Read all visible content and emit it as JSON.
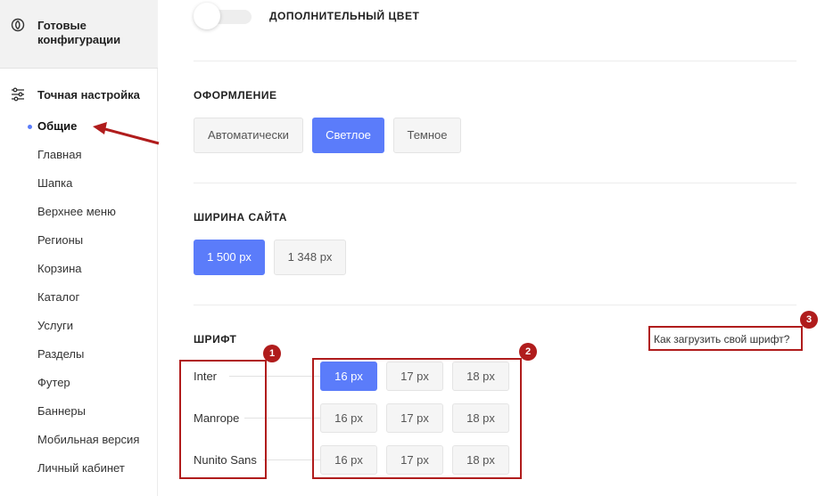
{
  "sidebar": {
    "ready_configs_label": "Готовые конфигурации",
    "fine_tune_label": "Точная настройка",
    "items": [
      {
        "label": "Общие"
      },
      {
        "label": "Главная"
      },
      {
        "label": "Шапка"
      },
      {
        "label": "Верхнее меню"
      },
      {
        "label": "Регионы"
      },
      {
        "label": "Корзина"
      },
      {
        "label": "Каталог"
      },
      {
        "label": "Услуги"
      },
      {
        "label": "Разделы"
      },
      {
        "label": "Футер"
      },
      {
        "label": "Баннеры"
      },
      {
        "label": "Мобильная версия"
      },
      {
        "label": "Личный кабинет"
      }
    ],
    "active_item": "Общие"
  },
  "extra_color": {
    "label": "ДОПОЛНИТЕЛЬНЫЙ ЦВЕТ",
    "enabled": false
  },
  "appearance": {
    "title": "ОФОРМЛЕНИЕ",
    "options": [
      "Автоматически",
      "Светлое",
      "Темное"
    ],
    "selected": "Светлое"
  },
  "site_width": {
    "title": "ШИРИНА САЙТА",
    "options": [
      "1 500 px",
      "1 348 px"
    ],
    "selected": "1 500 px"
  },
  "font": {
    "title": "ШРИФТ",
    "upload_link": "Как загрузить свой шрифт?",
    "families": [
      "Inter",
      "Manrope",
      "Nunito Sans"
    ],
    "sizes": [
      "16 px",
      "17 px",
      "18 px"
    ],
    "selected": {
      "family": "Inter",
      "size": "16 px"
    }
  },
  "annotations": [
    "1",
    "2",
    "3"
  ],
  "colors": {
    "accent": "#5b7cfa",
    "annotation": "#b01c1c",
    "sidebar_highlight": "#f2f2f2"
  }
}
